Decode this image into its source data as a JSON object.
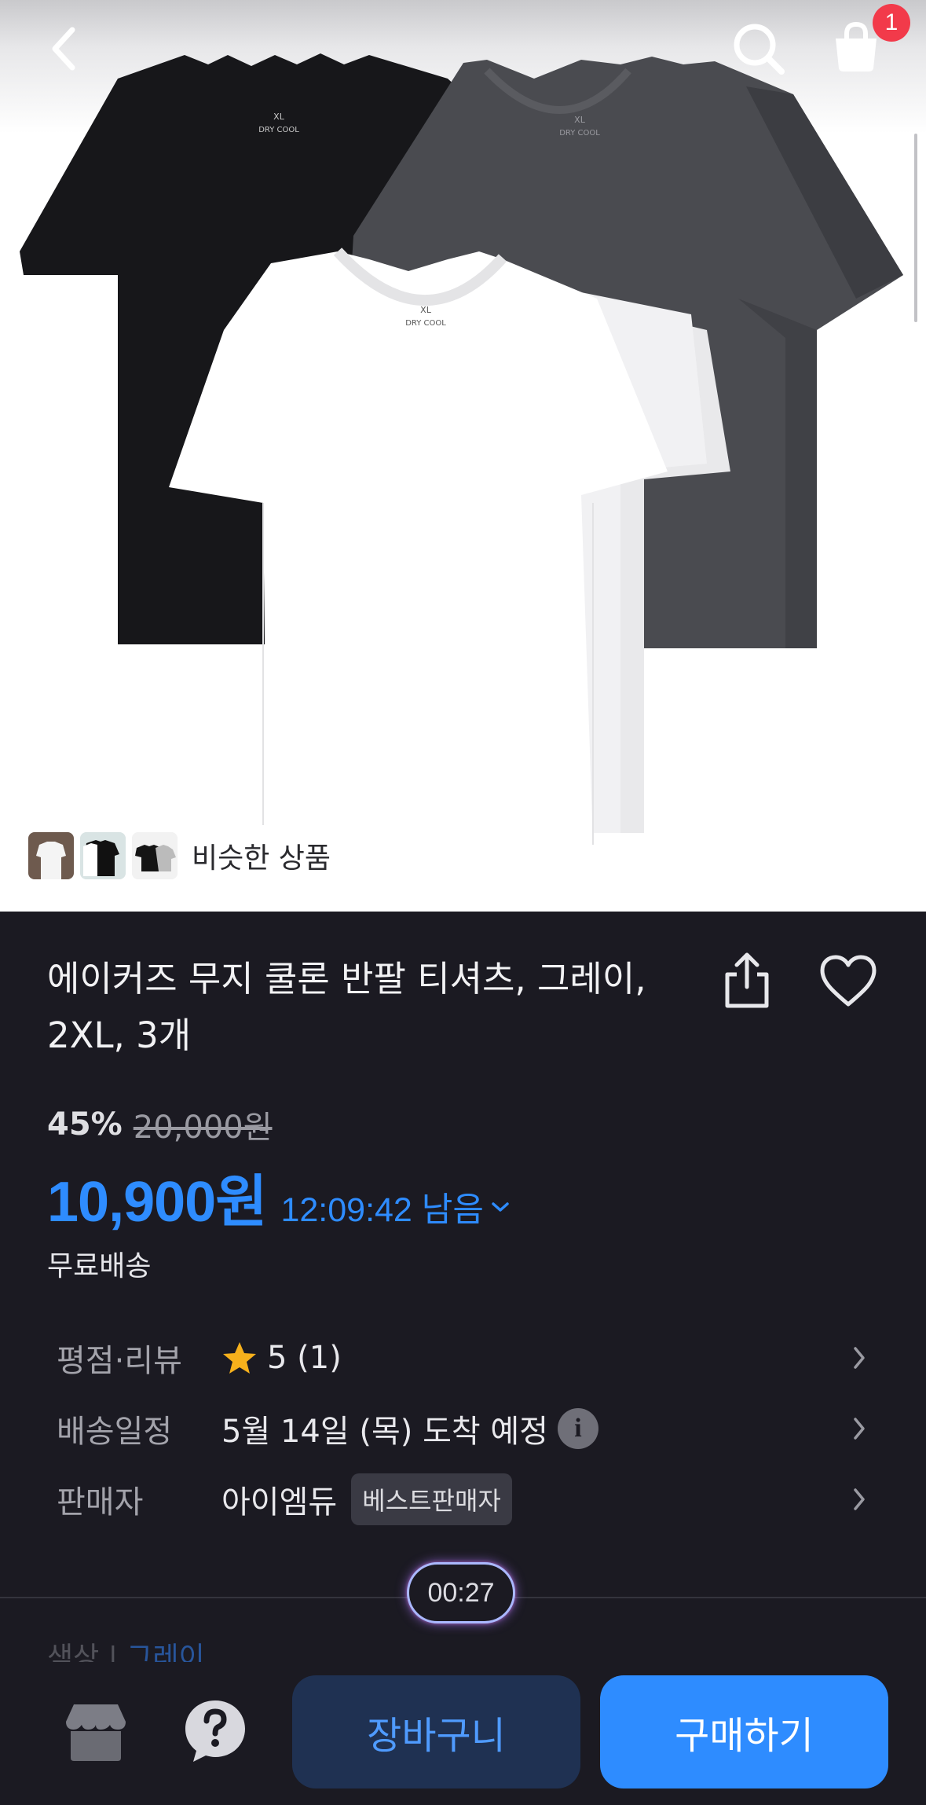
{
  "header": {
    "back_icon": "chevron-left-icon",
    "search_icon": "search-icon",
    "cart_icon": "shopping-bag-icon",
    "cart_badge": "1"
  },
  "hero": {
    "similar_label": "비슷한 상품",
    "image_text": {
      "size": "XL",
      "brand": "DRY COOL"
    }
  },
  "product": {
    "title": "에이커즈 무지 쿨론 반팔 티셔츠, 그레이, 2XL, 3개",
    "discount": "45%",
    "original_price": "20,000원",
    "sale_price": "10,900원",
    "timer": "12:09:42 남음",
    "shipping": "무료배송"
  },
  "info": {
    "rating_label": "평점·리뷰",
    "rating_value": "5 (1)",
    "delivery_label": "배송일정",
    "delivery_value": "5월 14일 (목) 도착 예정",
    "seller_label": "판매자",
    "seller_value": "아이엠듀",
    "seller_badge": "베스트판매자"
  },
  "video": {
    "timer": "00:27"
  },
  "option": {
    "label": "색상",
    "separator": "|",
    "value": "그레이"
  },
  "bottom": {
    "add_to_cart": "장바구니",
    "buy_now": "구매하기"
  },
  "colors": {
    "accent": "#2e8cff",
    "background": "#1b1a22",
    "badge": "#f23a4a",
    "star": "#f6b01c"
  }
}
